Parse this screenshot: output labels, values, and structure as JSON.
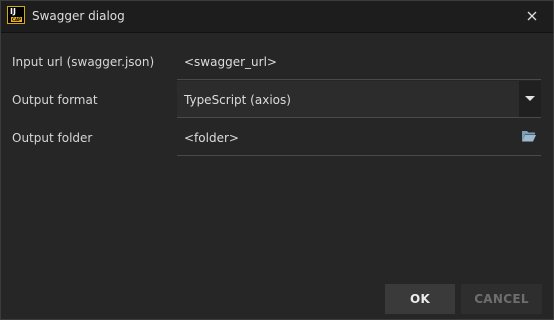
{
  "window": {
    "title": "Swagger dialog",
    "logo_text": "IJ",
    "logo_subtext": "CAP"
  },
  "form": {
    "input_url": {
      "label": "Input url (swagger.json)",
      "value": "<swagger_url>"
    },
    "output_format": {
      "label": "Output format",
      "selected": "TypeScript (axios)"
    },
    "output_folder": {
      "label": "Output folder",
      "value": "<folder>"
    }
  },
  "buttons": {
    "ok_label": "OK",
    "cancel_label": "CANCEL"
  },
  "icons": {
    "close": "close-icon",
    "dropdown": "chevron-down-icon",
    "folder": "folder-open-icon"
  },
  "colors": {
    "background": "#262626",
    "titlebar": "#1d1d1d",
    "text": "#dcdcdc",
    "logo_accent": "#f0b21e",
    "folder_icon": "#7e9fb8"
  }
}
